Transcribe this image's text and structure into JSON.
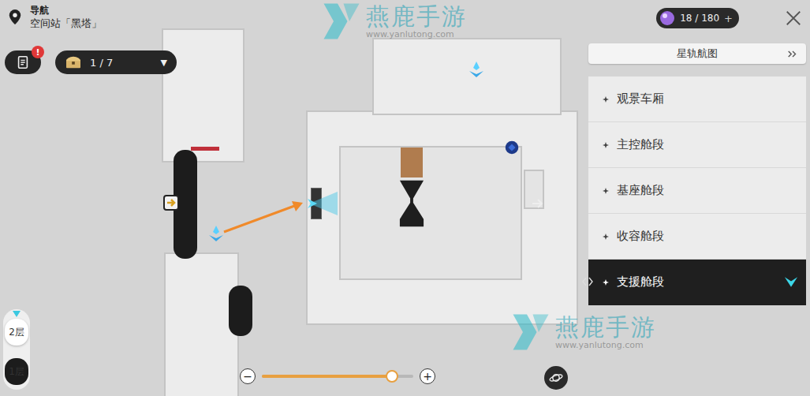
{
  "header": {
    "title": "导航",
    "location": "空间站「黑塔」"
  },
  "currency": {
    "amount": "18 / 180",
    "plus": "+"
  },
  "notice": {
    "badge": "!"
  },
  "chests": {
    "count": "1 / 7",
    "caret": "▼"
  },
  "star_rail_map": {
    "label": "星轨航图"
  },
  "areas": [
    {
      "label": "观景车厢",
      "selected": false
    },
    {
      "label": "主控舱段",
      "selected": false
    },
    {
      "label": "基座舱段",
      "selected": false
    },
    {
      "label": "收容舱段",
      "selected": false
    },
    {
      "label": "支援舱段",
      "selected": true
    }
  ],
  "floors": [
    {
      "label": "2层",
      "selected": true
    },
    {
      "label": "1层",
      "selected": false
    }
  ],
  "zoom": {
    "minus": "−",
    "plus": "+",
    "level": 0.86
  },
  "watermark": {
    "brand": "燕鹿手游",
    "url": "www.yanlutong.com"
  }
}
